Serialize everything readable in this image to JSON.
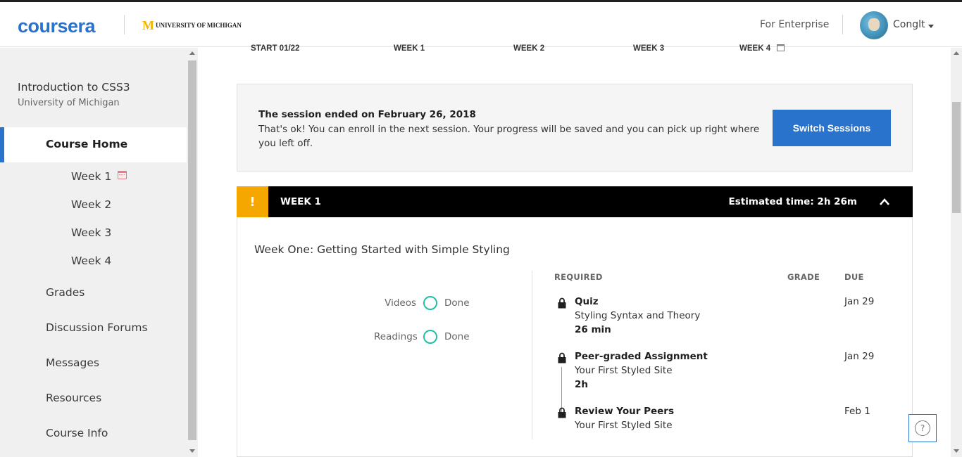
{
  "header": {
    "logo": "coursera",
    "partner_mark": "M",
    "partner_name": "UNIVERSITY OF MICHIGAN",
    "enterprise_link": "For Enterprise",
    "username": "Conglt"
  },
  "sidebar": {
    "course_title": "Introduction to CSS3",
    "course_org": "University of Michigan",
    "active_item": "Course Home",
    "weeks": [
      "Week 1",
      "Week 2",
      "Week 3",
      "Week 4"
    ],
    "items": [
      "Grades",
      "Discussion Forums",
      "Messages",
      "Resources",
      "Course Info"
    ]
  },
  "timeline": {
    "labels": [
      "START 01/22",
      "WEEK 1",
      "WEEK 2",
      "WEEK 3",
      "WEEK 4"
    ]
  },
  "session": {
    "title": "The session ended on February 26, 2018",
    "message": "That's ok! You can enroll in the next session. Your progress will be saved and you can pick up right where you left off.",
    "button": "Switch Sessions"
  },
  "week": {
    "warning_mark": "!",
    "label": "WEEK 1",
    "estimated": "Estimated time: 2h 26m",
    "heading": "Week One: Getting Started with Simple Styling",
    "progress": [
      {
        "label": "Videos",
        "status": "Done"
      },
      {
        "label": "Readings",
        "status": "Done"
      }
    ],
    "columns": {
      "required": "REQUIRED",
      "grade": "GRADE",
      "due": "DUE"
    },
    "items": [
      {
        "type": "Quiz",
        "title": "Styling Syntax and Theory",
        "time": "26 min",
        "due": "Jan 29"
      },
      {
        "type": "Peer-graded Assignment",
        "title": "Your First Styled Site",
        "time": "2h",
        "due": "Jan 29"
      },
      {
        "type": "Review Your Peers",
        "title": "Your First Styled Site",
        "time": "",
        "due": "Feb 1"
      }
    ]
  },
  "help": {
    "symbol": "?"
  },
  "colors": {
    "brand": "#2a73cc",
    "warning": "#f5a700",
    "progress": "#1fbfa8"
  }
}
